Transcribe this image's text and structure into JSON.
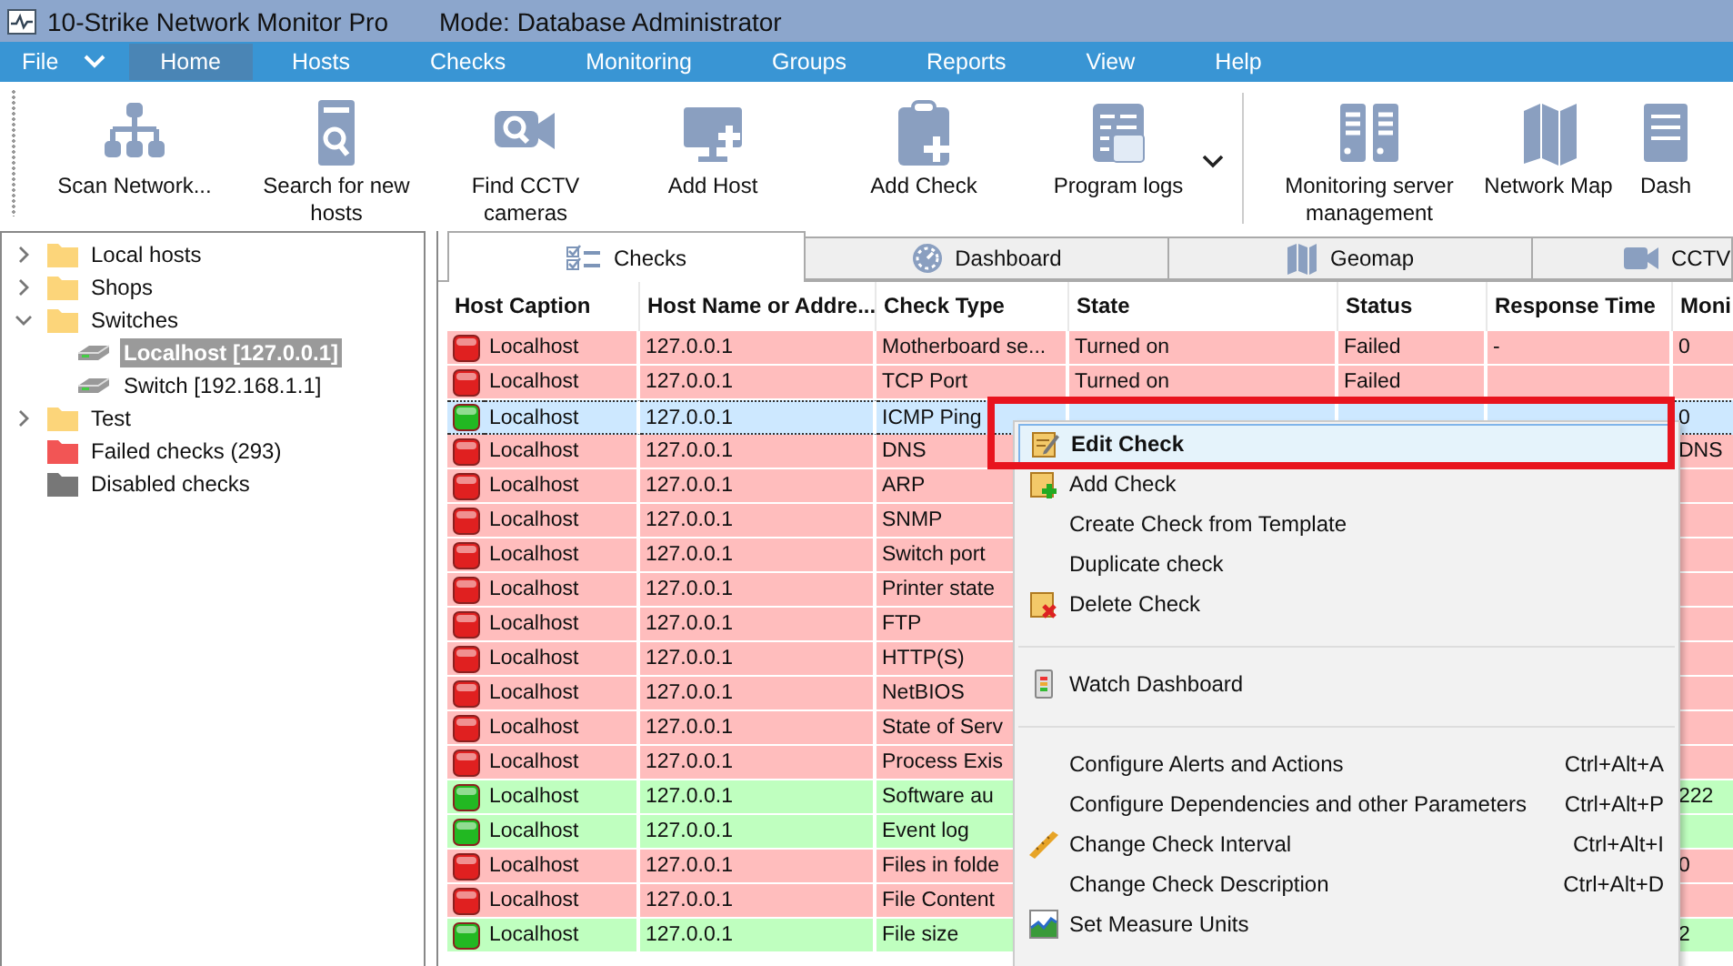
{
  "window": {
    "title": "10-Strike Network Monitor Pro",
    "mode": "Mode: Database Administrator"
  },
  "quick_access_caret": true,
  "menu": [
    {
      "label": "File",
      "selected": false
    },
    {
      "label": "Home",
      "selected": true
    },
    {
      "label": "Hosts",
      "selected": false
    },
    {
      "label": "Checks",
      "selected": false
    },
    {
      "label": "Monitoring",
      "selected": false
    },
    {
      "label": "Groups",
      "selected": false
    },
    {
      "label": "Reports",
      "selected": false
    },
    {
      "label": "View",
      "selected": false
    },
    {
      "label": "Help",
      "selected": false
    }
  ],
  "ribbon_groups": [
    [
      {
        "label": "Scan Network..."
      },
      {
        "label": "Search for new hosts"
      },
      {
        "label": "Find CCTV cameras"
      },
      {
        "label": "Add Host"
      },
      {
        "label": "Add Check"
      },
      {
        "label": "Program logs"
      }
    ],
    [
      {
        "label": "Monitoring server management"
      },
      {
        "label": "Network Map"
      },
      {
        "label": "Dash"
      }
    ]
  ],
  "tree": [
    {
      "label": "Local hosts",
      "kind": "folder",
      "expanded": false,
      "selected": false
    },
    {
      "label": "Shops",
      "kind": "folder",
      "expanded": false,
      "selected": false
    },
    {
      "label": "Switches",
      "kind": "folder",
      "expanded": true,
      "selected": false,
      "children": [
        {
          "label": "Localhost [127.0.0.1]",
          "selected": true
        },
        {
          "label": "Switch [192.168.1.1]",
          "selected": false
        }
      ]
    },
    {
      "label": "Test",
      "kind": "folder",
      "expanded": false,
      "selected": false
    },
    {
      "label": "Failed checks (293)",
      "kind": "failed",
      "selected": false
    },
    {
      "label": "Disabled checks",
      "kind": "disabled",
      "selected": false
    }
  ],
  "tabs": [
    {
      "label": "Checks",
      "selected": true
    },
    {
      "label": "Dashboard",
      "selected": false
    },
    {
      "label": "Geomap",
      "selected": false
    },
    {
      "label": "CCTV",
      "selected": false
    }
  ],
  "table": {
    "columns": [
      "Host Caption",
      "Host Name or Addre...",
      "Check Type",
      "State",
      "Status",
      "Response Time",
      "Moni"
    ],
    "rows": [
      {
        "failed": true,
        "selected": false,
        "cells": [
          "Localhost",
          "127.0.0.1",
          "Motherboard se...",
          "Turned on",
          "Failed",
          "-",
          "0"
        ]
      },
      {
        "failed": true,
        "selected": false,
        "cells": [
          "Localhost",
          "127.0.0.1",
          "TCP Port",
          "Turned on",
          "Failed",
          "",
          ""
        ]
      },
      {
        "failed": false,
        "selected": true,
        "cells": [
          "Localhost",
          "127.0.0.1",
          "ICMP Ping",
          "",
          "",
          "",
          "0"
        ]
      },
      {
        "failed": true,
        "selected": false,
        "cells": [
          "Localhost",
          "127.0.0.1",
          "DNS",
          "",
          "",
          "",
          "DNS"
        ]
      },
      {
        "failed": true,
        "selected": false,
        "cells": [
          "Localhost",
          "127.0.0.1",
          "ARP",
          "",
          "",
          "",
          ""
        ]
      },
      {
        "failed": true,
        "selected": false,
        "cells": [
          "Localhost",
          "127.0.0.1",
          "SNMP",
          "",
          "",
          "",
          ""
        ]
      },
      {
        "failed": true,
        "selected": false,
        "cells": [
          "Localhost",
          "127.0.0.1",
          "Switch port",
          "",
          "",
          "",
          ""
        ]
      },
      {
        "failed": true,
        "selected": false,
        "cells": [
          "Localhost",
          "127.0.0.1",
          "Printer state",
          "",
          "",
          "",
          ""
        ]
      },
      {
        "failed": true,
        "selected": false,
        "cells": [
          "Localhost",
          "127.0.0.1",
          "FTP",
          "",
          "",
          "",
          ""
        ]
      },
      {
        "failed": true,
        "selected": false,
        "cells": [
          "Localhost",
          "127.0.0.1",
          "HTTP(S)",
          "",
          "",
          "",
          ""
        ]
      },
      {
        "failed": true,
        "selected": false,
        "cells": [
          "Localhost",
          "127.0.0.1",
          "NetBIOS",
          "",
          "",
          "",
          ""
        ]
      },
      {
        "failed": true,
        "selected": false,
        "cells": [
          "Localhost",
          "127.0.0.1",
          "State of Serv",
          "",
          "",
          "",
          ""
        ]
      },
      {
        "failed": true,
        "selected": false,
        "cells": [
          "Localhost",
          "127.0.0.1",
          "Process Exis",
          "",
          "",
          "",
          ""
        ]
      },
      {
        "failed": false,
        "selected": false,
        "cells": [
          "Localhost",
          "127.0.0.1",
          "Software au",
          "",
          "",
          "",
          "222"
        ]
      },
      {
        "failed": false,
        "selected": false,
        "cells": [
          "Localhost",
          "127.0.0.1",
          "Event log",
          "",
          "",
          "",
          ""
        ]
      },
      {
        "failed": true,
        "selected": false,
        "cells": [
          "Localhost",
          "127.0.0.1",
          "Files in folde",
          "",
          "",
          "",
          "0"
        ]
      },
      {
        "failed": true,
        "selected": false,
        "cells": [
          "Localhost",
          "127.0.0.1",
          "File Content",
          "",
          "",
          "",
          ""
        ]
      },
      {
        "failed": false,
        "selected": false,
        "cells": [
          "Localhost",
          "127.0.0.1",
          "File size",
          "",
          "",
          "",
          "2"
        ]
      }
    ]
  },
  "context_menu": {
    "groups": [
      [
        {
          "label": "Edit Check",
          "kind": "edit",
          "selected": true
        },
        {
          "label": "Add Check",
          "kind": "add",
          "selected": false
        },
        {
          "label": "Create Check from Template",
          "kind": "none",
          "selected": false
        },
        {
          "label": "Duplicate check",
          "kind": "none",
          "selected": false
        },
        {
          "label": "Delete Check",
          "kind": "delete",
          "selected": false
        }
      ],
      [
        {
          "label": "Watch Dashboard",
          "kind": "dashboard",
          "selected": false
        }
      ],
      [
        {
          "label": "Configure Alerts and Actions",
          "shortcut": "Ctrl+Alt+A",
          "kind": "none",
          "selected": false
        },
        {
          "label": "Configure Dependencies and other Parameters",
          "shortcut": "Ctrl+Alt+P",
          "kind": "none",
          "selected": false
        },
        {
          "label": "Change Check Interval",
          "shortcut": "Ctrl+Alt+I",
          "kind": "ruler",
          "selected": false
        },
        {
          "label": "Change Check Description",
          "shortcut": "Ctrl+Alt+D",
          "kind": "none",
          "selected": false
        },
        {
          "label": "Set Measure Units",
          "kind": "chart",
          "selected": false
        }
      ]
    ]
  }
}
